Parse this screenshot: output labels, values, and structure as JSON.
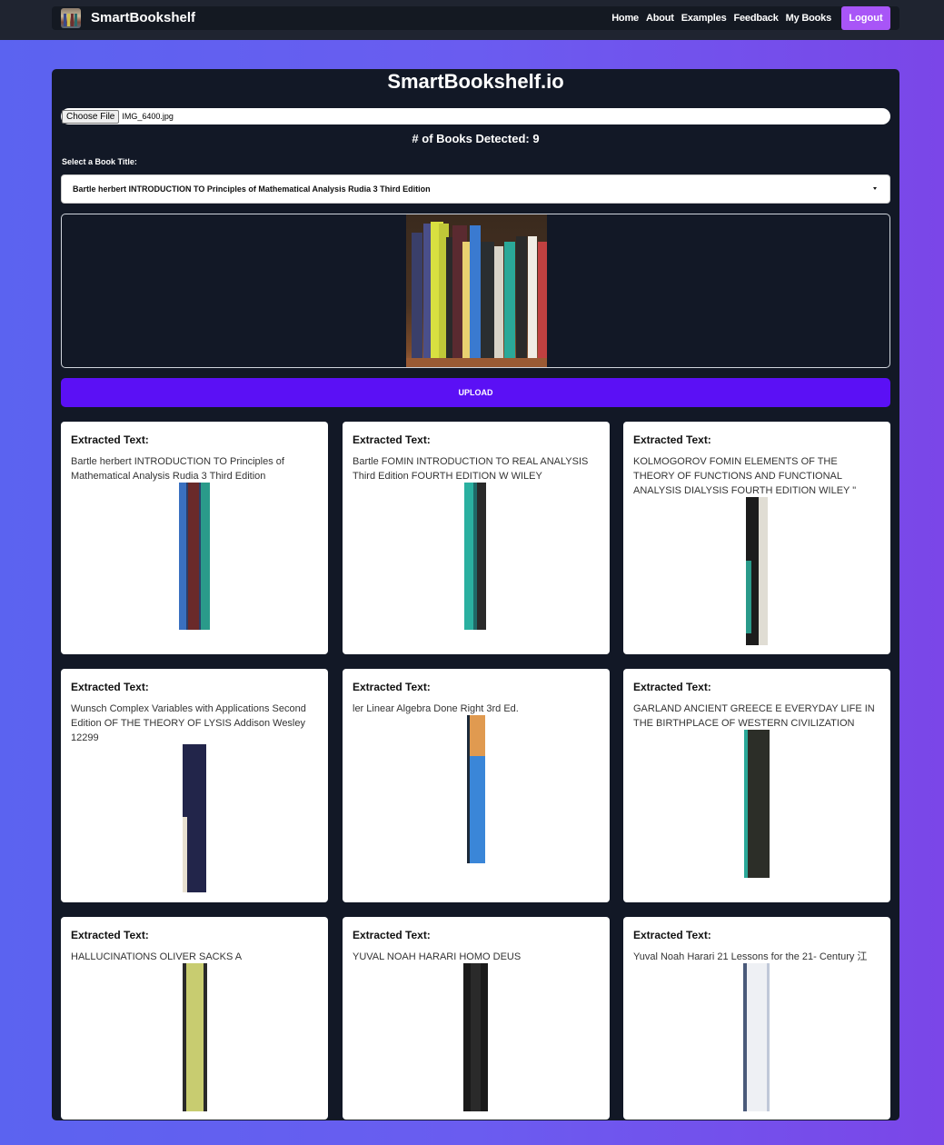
{
  "nav": {
    "brand": "SmartBookshelf",
    "links": [
      "Home",
      "About",
      "Examples",
      "Feedback",
      "My Books"
    ],
    "logout": "Logout"
  },
  "main": {
    "title": "SmartBookshelf.io",
    "file_button": "Choose File",
    "file_name": "IMG_6400.jpg",
    "detected": "# of Books Detected: 9",
    "select_label": "Select a Book Title:",
    "selected_title": "Bartle herbert INTRODUCTION TO Principles of Mathematical Analysis Rudia 3 Third Edition",
    "upload": "UPLOAD"
  },
  "cards": [
    {
      "heading": "Extracted Text:",
      "text": "Bartle herbert INTRODUCTION TO Principles of Mathematical Analysis Rudia 3 Third Edition"
    },
    {
      "heading": "Extracted Text:",
      "text": "Bartle FOMIN INTRODUCTION TO REAL ANALYSIS Third Edition FOURTH EDITION W WILEY"
    },
    {
      "heading": "Extracted Text:",
      "text": "KOLMOGOROV FOMIN ELEMENTS OF THE THEORY OF FUNCTIONS AND FUNCTIONAL ANALYSIS DIALYSIS FOURTH EDITION WILEY \""
    },
    {
      "heading": "Extracted Text:",
      "text": "Wunsch Complex Variables with Applications Second Edition OF THE THEORY OF LYSIS Addison Wesley 12299"
    },
    {
      "heading": "Extracted Text:",
      "text": "ler Linear Algebra Done Right 3rd Ed."
    },
    {
      "heading": "Extracted Text:",
      "text": "GARLAND ANCIENT GREECE E EVERYDAY LIFE IN THE BIRTHPLACE OF WESTERN CIVILIZATION"
    },
    {
      "heading": "Extracted Text:",
      "text": "HALLUCINATIONS OLIVER SACKS A"
    },
    {
      "heading": "Extracted Text:",
      "text": "YUVAL NOAH HARARI HOMO DEUS"
    },
    {
      "heading": "Extracted Text:",
      "text": "Yuval Noah Harari 21 Lessons for the 21- Century 江"
    }
  ],
  "colors": {
    "accent": "#5b10f5",
    "logout": "#a855f7",
    "panel": "#121826",
    "navbar": "#141922"
  }
}
